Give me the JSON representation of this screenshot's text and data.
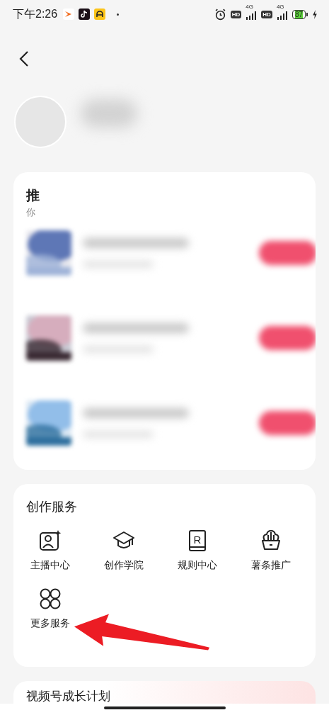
{
  "status_bar": {
    "time": "下午2:26",
    "networks": [
      {
        "badge": "HD",
        "type": "4G"
      },
      {
        "badge": "HD",
        "type": "4G"
      }
    ],
    "battery": "87"
  },
  "recommend_card": {
    "title": "推",
    "subtitle": "你"
  },
  "services": {
    "title": "创作服务",
    "items": [
      {
        "label": "主播中心"
      },
      {
        "label": "创作学院"
      },
      {
        "label": "规则中心",
        "icon_text": "R"
      },
      {
        "label": "薯条推广"
      },
      {
        "label": "更多服务"
      }
    ]
  },
  "growth_card": {
    "title": "视频号成长计划"
  }
}
